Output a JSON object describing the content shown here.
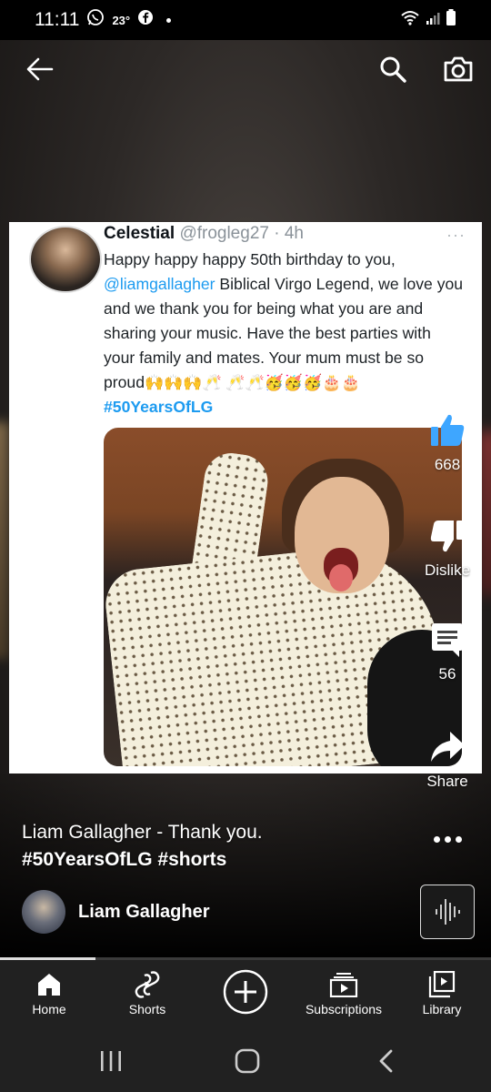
{
  "status_bar": {
    "time": "11:11",
    "temperature": "23°"
  },
  "tweet": {
    "name": "Celestial",
    "handle": "@frogleg27 · 4h",
    "text_1": "Happy happy happy 50th birthday to you, ",
    "mention": "@liamgallagher",
    "text_2": " Biblical Virgo Legend, we love you and we thank you for being what you are and sharing your music. Have the best parties with your family and mates. Your mum must be so proud",
    "emojis": "🙌🙌🙌🥂 🥂🥂🥳🥳🥳🎂🎂",
    "hashtag": "#50YearsOfLG"
  },
  "actions": {
    "like_count": "668",
    "dislike_label": "Dislike",
    "comment_count": "56",
    "share_label": "Share"
  },
  "caption": {
    "line1": "Liam Gallagher - Thank you.",
    "line2": "#50YearsOfLG #shorts"
  },
  "channel": {
    "name": "Liam Gallagher"
  },
  "nav": {
    "home": "Home",
    "shorts": "Shorts",
    "subscriptions": "Subscriptions",
    "library": "Library"
  },
  "colors": {
    "like_active": "#3ea6ff",
    "link_blue": "#1d9bf0",
    "nav_background": "#212121"
  },
  "progress_fraction": 0.195
}
